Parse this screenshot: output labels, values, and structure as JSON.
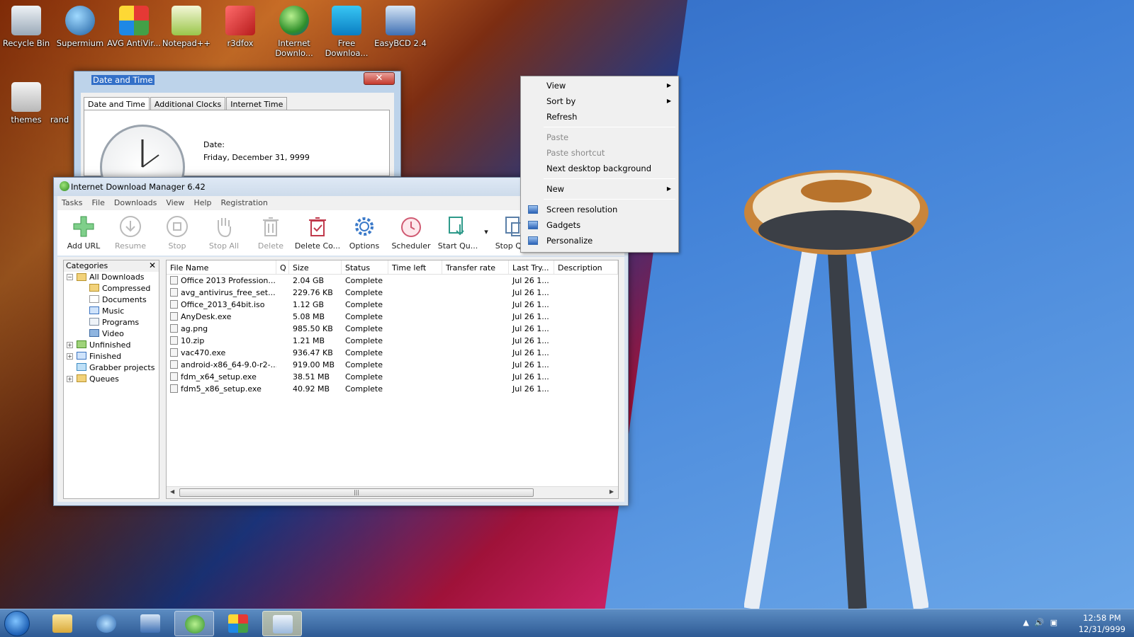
{
  "desktop": {
    "icons": [
      {
        "label": "Recycle Bin"
      },
      {
        "label": "Supermium"
      },
      {
        "label": "AVG AntiVir..."
      },
      {
        "label": "Notepad++"
      },
      {
        "label": "r3dfox"
      },
      {
        "label": "Internet Downlo..."
      },
      {
        "label": "Free Downloa..."
      },
      {
        "label": "EasyBCD 2.4"
      },
      {
        "label": "themes"
      },
      {
        "label": "rand"
      }
    ]
  },
  "datetime_dialog": {
    "title": "Date and Time",
    "tabs": [
      "Date and Time",
      "Additional Clocks",
      "Internet Time"
    ],
    "date_label": "Date:",
    "date_value": "Friday, December 31, 9999"
  },
  "idm": {
    "title": "Internet Download Manager 6.42",
    "menu": [
      "Tasks",
      "File",
      "Downloads",
      "View",
      "Help",
      "Registration"
    ],
    "toolbar": [
      {
        "label": "Add URL",
        "icon": "plus-icon",
        "enabled": true
      },
      {
        "label": "Resume",
        "icon": "resume-icon",
        "enabled": false
      },
      {
        "label": "Stop",
        "icon": "stop-icon",
        "enabled": false
      },
      {
        "label": "Stop All",
        "icon": "hand-icon",
        "enabled": false
      },
      {
        "label": "Delete",
        "icon": "trash-icon",
        "enabled": false
      },
      {
        "label": "Delete Co...",
        "icon": "delete-completed-icon",
        "enabled": true
      },
      {
        "label": "Options",
        "icon": "gear-icon",
        "enabled": true
      },
      {
        "label": "Scheduler",
        "icon": "clock-icon",
        "enabled": true
      },
      {
        "label": "Start Qu...",
        "icon": "start-queue-icon",
        "enabled": true
      },
      {
        "label": "Stop Qu...",
        "icon": "stop-queue-icon",
        "enabled": true
      }
    ],
    "categories_title": "Categories",
    "categories": [
      {
        "label": "All Downloads",
        "level": 0,
        "expanded": true
      },
      {
        "label": "Compressed",
        "level": 1
      },
      {
        "label": "Documents",
        "level": 1
      },
      {
        "label": "Music",
        "level": 1
      },
      {
        "label": "Programs",
        "level": 1
      },
      {
        "label": "Video",
        "level": 1
      },
      {
        "label": "Unfinished",
        "level": 0,
        "expandable": true
      },
      {
        "label": "Finished",
        "level": 0,
        "expandable": true
      },
      {
        "label": "Grabber projects",
        "level": 0
      },
      {
        "label": "Queues",
        "level": 0,
        "expandable": true
      }
    ],
    "columns": [
      "File Name",
      "Q",
      "Size",
      "Status",
      "Time left",
      "Transfer rate",
      "Last Try...",
      "Description"
    ],
    "files": [
      {
        "name": "Office 2013 Profession...",
        "size": "2.04  GB",
        "status": "Complete",
        "last_try": "Jul 26 1..."
      },
      {
        "name": "avg_antivirus_free_set...",
        "size": "229.76  KB",
        "status": "Complete",
        "last_try": "Jul 26 1..."
      },
      {
        "name": "Office_2013_64bit.iso",
        "size": "1.12  GB",
        "status": "Complete",
        "last_try": "Jul 26 1..."
      },
      {
        "name": "AnyDesk.exe",
        "size": "5.08  MB",
        "status": "Complete",
        "last_try": "Jul 26 1..."
      },
      {
        "name": "ag.png",
        "size": "985.50  KB",
        "status": "Complete",
        "last_try": "Jul 26 1..."
      },
      {
        "name": "10.zip",
        "size": "1.21  MB",
        "status": "Complete",
        "last_try": "Jul 26 1..."
      },
      {
        "name": "vac470.exe",
        "size": "936.47  KB",
        "status": "Complete",
        "last_try": "Jul 26 1..."
      },
      {
        "name": "android-x86_64-9.0-r2-...",
        "size": "919.00  MB",
        "status": "Complete",
        "last_try": "Jul 26 1..."
      },
      {
        "name": "fdm_x64_setup.exe",
        "size": "38.51  MB",
        "status": "Complete",
        "last_try": "Jul 26 1..."
      },
      {
        "name": "fdm5_x86_setup.exe",
        "size": "40.92  MB",
        "status": "Complete",
        "last_try": "Jul 26 1..."
      }
    ]
  },
  "context_menu": {
    "items": [
      {
        "label": "View",
        "submenu": true,
        "enabled": true
      },
      {
        "label": "Sort by",
        "submenu": true,
        "enabled": true
      },
      {
        "label": "Refresh",
        "enabled": true
      },
      {
        "separator": true
      },
      {
        "label": "Paste",
        "enabled": false
      },
      {
        "label": "Paste shortcut",
        "enabled": false
      },
      {
        "label": "Next desktop background",
        "enabled": true
      },
      {
        "separator": true
      },
      {
        "label": "New",
        "submenu": true,
        "enabled": true
      },
      {
        "separator": true
      },
      {
        "label": "Screen resolution",
        "enabled": true,
        "icon": "screen-resolution-icon"
      },
      {
        "label": "Gadgets",
        "enabled": true,
        "icon": "gadgets-icon"
      },
      {
        "label": "Personalize",
        "enabled": true,
        "icon": "personalize-icon"
      }
    ]
  },
  "taskbar": {
    "time": "12:58 PM",
    "date": "12/31/9999"
  }
}
